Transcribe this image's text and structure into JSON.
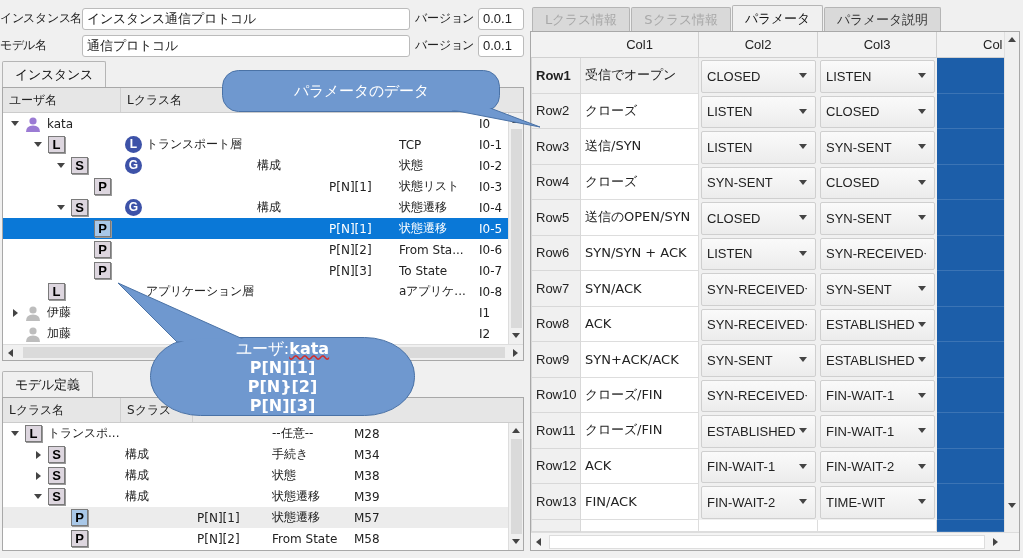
{
  "instance_form": {
    "name_label": "インスタンス名",
    "name_value": "インスタンス通信プロトコル",
    "version_label": "バージョン",
    "version_value": "0.0.1"
  },
  "model_form": {
    "name_label": "モデル名",
    "name_value": "通信プロトコル",
    "version_label": "バージョン",
    "version_value": "0.0.1"
  },
  "instance_panel": {
    "tab": "インスタンス",
    "focused": true,
    "columns": [
      "ユーザ名",
      "Lクラス名"
    ],
    "rows": [
      {
        "kind": "user",
        "active": true,
        "expanded": true,
        "selected": false,
        "name": "kata",
        "column_6": "I0",
        "children": [
          {
            "kind": "class",
            "badge": "L",
            "expanded": true,
            "selected": false,
            "circle": "L",
            "column_2": "トランスポート層",
            "column_5": "TCP",
            "column_6": "I0-1",
            "children": [
              {
                "kind": "class",
                "badge": "S",
                "expanded": true,
                "selected": false,
                "circle": "G",
                "column_3": "構成",
                "column_5": "状態",
                "column_6": "I0-2",
                "children": [
                  {
                    "kind": "class",
                    "badge": "P",
                    "selected": false,
                    "column_4": "P[N][1]",
                    "column_5": "状態リスト",
                    "column_6": "I0-3"
                  }
                ]
              },
              {
                "kind": "class",
                "badge": "S",
                "expanded": true,
                "selected": false,
                "circle": "G",
                "column_3": "構成",
                "column_5": "状態遷移",
                "column_6": "I0-4",
                "children": [
                  {
                    "kind": "class",
                    "badge": "P",
                    "selected": true,
                    "column_4": "P[N][1]",
                    "column_5": "状態遷移",
                    "column_6": "I0-5"
                  },
                  {
                    "kind": "class",
                    "badge": "P",
                    "selected": false,
                    "column_4": "P[N][2]",
                    "column_5": "From Sta...",
                    "column_6": "I0-6"
                  },
                  {
                    "kind": "class",
                    "badge": "P",
                    "selected": false,
                    "column_4": "P[N][3]",
                    "column_5": "To State",
                    "column_6": "I0-7"
                  }
                ]
              }
            ]
          },
          {
            "kind": "class",
            "badge": "L",
            "selected": false,
            "column_2": "アプリケーション層",
            "column_5": "aアプリケ...",
            "column_6": "I0-8"
          }
        ]
      },
      {
        "kind": "user",
        "active": false,
        "expanded": false,
        "selected": false,
        "name": "伊藤",
        "column_6": "I1"
      },
      {
        "kind": "user",
        "active": false,
        "selected": false,
        "name": "加藤",
        "column_6": "I2"
      }
    ]
  },
  "model_panel": {
    "tab": "モデル定義",
    "focused": false,
    "columns": [
      "Lクラス名",
      "Sクラス"
    ],
    "rows": [
      {
        "kind": "class",
        "badge": "L",
        "expanded": true,
        "selected": false,
        "name": "トランスポ...",
        "column_4": "--任意--",
        "column_5": "M28",
        "children": [
          {
            "kind": "class",
            "badge": "S",
            "expanded": false,
            "selected": false,
            "column_2": "構成",
            "column_4": "手続き",
            "column_5": "M34"
          },
          {
            "kind": "class",
            "badge": "S",
            "expanded": false,
            "selected": false,
            "column_2": "構成",
            "column_4": "状態",
            "column_5": "M38"
          },
          {
            "kind": "class",
            "badge": "S",
            "expanded": true,
            "selected": false,
            "column_2": "構成",
            "column_4": "状態遷移",
            "column_5": "M39",
            "children": [
              {
                "kind": "class",
                "badge": "P",
                "selected": true,
                "column_3": "P[N][1]",
                "column_4": "状態遷移",
                "column_5": "M57"
              },
              {
                "kind": "class",
                "badge": "P",
                "selected": false,
                "column_3": "P[N][2]",
                "column_4": "From State",
                "column_5": "M58"
              }
            ]
          }
        ]
      }
    ]
  },
  "detail_tabs": [
    {
      "label": "Lクラス情報",
      "selected": false,
      "disabled": true
    },
    {
      "label": "Sクラス情報",
      "selected": false,
      "disabled": true
    },
    {
      "label": "パラメータ",
      "selected": true,
      "disabled": false
    },
    {
      "label": "パラメータ説明",
      "selected": false,
      "disabled": false
    }
  ],
  "table": {
    "columns": [
      {
        "label": "Col1",
        "kind": "text",
        "selected": false
      },
      {
        "label": "Col2",
        "kind": "combo",
        "selected": false
      },
      {
        "label": "Col3",
        "kind": "combo",
        "selected": false
      },
      {
        "label": "Col",
        "kind": "blank",
        "selected": true
      }
    ],
    "rows": [
      {
        "label": "Row1",
        "selected": true,
        "cells": [
          "受信でオープン",
          "CLOSED",
          "LISTEN"
        ]
      },
      {
        "label": "Row2",
        "selected": false,
        "cells": [
          "クローズ",
          "LISTEN",
          "CLOSED"
        ]
      },
      {
        "label": "Row3",
        "selected": false,
        "cells": [
          "送信/SYN",
          "LISTEN",
          "SYN-SENT"
        ]
      },
      {
        "label": "Row4",
        "selected": false,
        "cells": [
          "クローズ",
          "SYN-SENT",
          "CLOSED"
        ]
      },
      {
        "label": "Row5",
        "selected": false,
        "cells": [
          "送信のOPEN/SYN",
          "CLOSED",
          "SYN-SENT"
        ]
      },
      {
        "label": "Row6",
        "selected": false,
        "cells": [
          "SYN/SYN + ACK",
          "LISTEN",
          "SYN-RECEIVED"
        ]
      },
      {
        "label": "Row7",
        "selected": false,
        "cells": [
          "SYN/ACK",
          "SYN-RECEIVED",
          "SYN-SENT"
        ]
      },
      {
        "label": "Row8",
        "selected": false,
        "cells": [
          "ACK",
          "SYN-RECEIVED",
          "ESTABLISHED"
        ]
      },
      {
        "label": "Row9",
        "selected": false,
        "cells": [
          "SYN+ACK/ACK",
          "SYN-SENT",
          "ESTABLISHED"
        ]
      },
      {
        "label": "Row10",
        "selected": false,
        "cells": [
          "クローズ/FIN",
          "SYN-RECEIVED",
          "FIN-WAIT-1"
        ]
      },
      {
        "label": "Row11",
        "selected": false,
        "cells": [
          "クローズ/FIN",
          "ESTABLISHED",
          "FIN-WAIT-1"
        ]
      },
      {
        "label": "Row12",
        "selected": false,
        "cells": [
          "ACK",
          "FIN-WAIT-1",
          "FIN-WAIT-2"
        ]
      },
      {
        "label": "Row13",
        "selected": false,
        "cells": [
          "FIN/ACK",
          "FIN-WAIT-2",
          "TIME-WIT"
        ]
      }
    ]
  },
  "callouts": [
    {
      "lines": [
        {
          "text": "パラメータのデータ",
          "bold": false
        }
      ]
    },
    {
      "lines": [
        {
          "text": "ユーザ:**kata**",
          "bold": false
        },
        {
          "text": "P[N][1]",
          "bold": true
        },
        {
          "text": "P[N}[2]",
          "bold": true
        },
        {
          "text": "P[N][3]",
          "bold": true
        }
      ]
    }
  ]
}
